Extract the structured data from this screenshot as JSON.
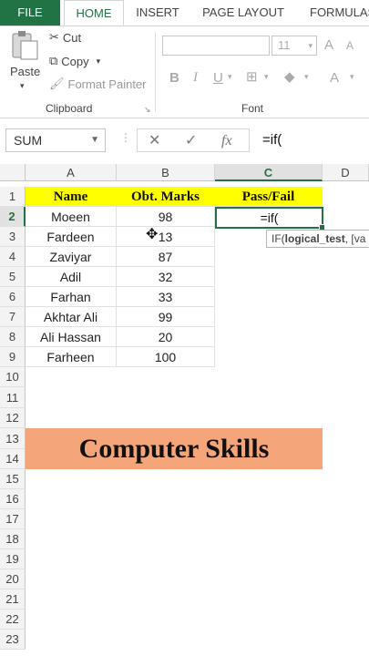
{
  "tabs": [
    "FILE",
    "HOME",
    "INSERT",
    "PAGE LAYOUT",
    "FORMULAS"
  ],
  "ribbon": {
    "paste": "Paste",
    "cut": "Cut",
    "copy": "Copy",
    "format_painter": "Format Painter",
    "clipboard_label": "Clipboard",
    "font_label": "Font",
    "font_size": "11",
    "bold": "B",
    "italic": "I",
    "underline": "U",
    "grow": "A",
    "shrink": "A",
    "font_color": "A"
  },
  "formula_bar": {
    "name_box": "SUM",
    "cancel": "✕",
    "enter": "✓",
    "fx": "fx",
    "content": "=if("
  },
  "columns": [
    "A",
    "B",
    "C",
    "D"
  ],
  "rows": [
    "1",
    "2",
    "3",
    "4",
    "5",
    "6",
    "7",
    "8",
    "9",
    "10",
    "11",
    "12",
    "13",
    "14",
    "15",
    "16",
    "17",
    "18",
    "19",
    "20",
    "21",
    "22",
    "23"
  ],
  "table_header": {
    "name": "Name",
    "marks": "Obt. Marks",
    "result": "Pass/Fail"
  },
  "students": [
    {
      "name": "Moeen",
      "marks": "98"
    },
    {
      "name": "Fardeen",
      "marks": "13"
    },
    {
      "name": "Zaviyar",
      "marks": "87"
    },
    {
      "name": "Adil",
      "marks": "32"
    },
    {
      "name": "Farhan",
      "marks": "33"
    },
    {
      "name": "Akhtar Ali",
      "marks": "99"
    },
    {
      "name": "Ali Hassan",
      "marks": "20"
    },
    {
      "name": "Farheen",
      "marks": "100"
    }
  ],
  "active_cell_text": "=if(",
  "tooltip": {
    "fn": "IF(",
    "arg1": "logical_test",
    ", rest": ", [va"
  },
  "banner": "Computer Skills",
  "colors": {
    "accent": "#217346",
    "header_fill": "#ffff00",
    "banner_fill": "#f4a67a"
  }
}
